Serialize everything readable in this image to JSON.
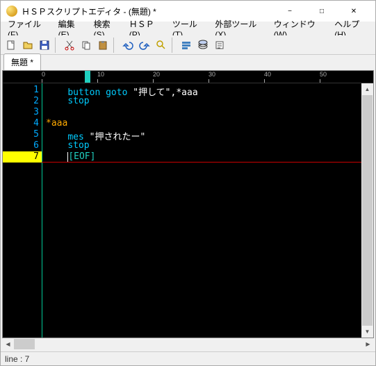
{
  "window": {
    "title": "ＨＳＰスクリプトエディタ - (無題) *"
  },
  "menu": {
    "file": "ファイル(F)",
    "edit": "編集(E)",
    "search": "検索(S)",
    "hsp": "ＨＳＰ(P)",
    "tools": "ツール(T)",
    "exttools": "外部ツール(X)",
    "window": "ウィンドウ(W)",
    "help": "ヘルプ(H)"
  },
  "tab": {
    "label": "無題 *"
  },
  "ruler": {
    "t10": "10",
    "t20": "20",
    "t30": "30",
    "t40": "40",
    "t50": "50"
  },
  "lines": {
    "n1": "1",
    "n2": "2",
    "n3": "3",
    "n4": "4",
    "n5": "5",
    "n6": "6",
    "n7": "7"
  },
  "code": {
    "l1": {
      "indent": "    ",
      "kw1": "button",
      "sp": " ",
      "kw2": "goto",
      "sp2": " ",
      "str": "\"押して\"",
      "rest": ",*aaa"
    },
    "l2": {
      "indent": "    ",
      "kw": "stop"
    },
    "l4": {
      "label": "*aaa"
    },
    "l5": {
      "indent": "    ",
      "kw": "mes",
      "sp": " ",
      "str": "\"押されたー\""
    },
    "l6": {
      "indent": "    ",
      "kw": "stop"
    },
    "l7": {
      "indent": "    ",
      "eof": "[EOF]"
    }
  },
  "status": {
    "line": "line : 7"
  }
}
